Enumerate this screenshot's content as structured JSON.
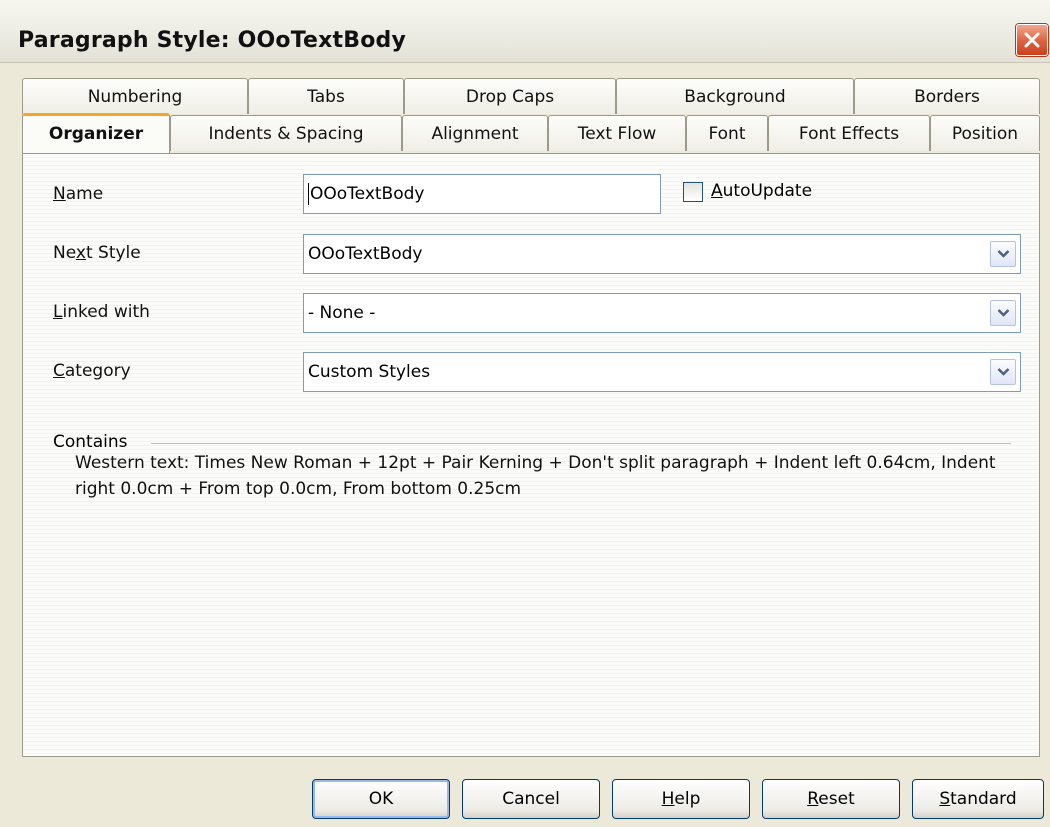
{
  "window": {
    "title": "Paragraph Style: OOoTextBody"
  },
  "tabs": {
    "row1": [
      "Numbering",
      "Tabs",
      "Drop Caps",
      "Background",
      "Borders"
    ],
    "row2": [
      "Organizer",
      "Indents & Spacing",
      "Alignment",
      "Text Flow",
      "Font",
      "Font Effects",
      "Position"
    ],
    "active": "Organizer"
  },
  "organizer": {
    "name": {
      "label_pre": "",
      "label_key": "N",
      "label_post": "ame",
      "value": "OOoTextBody"
    },
    "autoupdate": {
      "label_pre": "",
      "label_key": "A",
      "label_post": "utoUpdate",
      "checked": false
    },
    "next_style": {
      "label_pre": "Ne",
      "label_key": "x",
      "label_post": "t Style",
      "value": "OOoTextBody"
    },
    "linked_with": {
      "label_pre": "",
      "label_key": "L",
      "label_post": "inked with",
      "value": "- None -"
    },
    "category": {
      "label_pre": "",
      "label_key": "C",
      "label_post": "ategory",
      "value": "Custom Styles"
    },
    "contains_label": "Contains",
    "contains_text": "Western text: Times New Roman + 12pt + Pair Kerning + Don't split paragraph + Indent left 0.64cm, Indent right 0.0cm + From top 0.0cm, From bottom 0.25cm"
  },
  "buttons": {
    "ok": {
      "pre": "OK",
      "key": "",
      "post": ""
    },
    "cancel": {
      "pre": "Cancel",
      "key": "",
      "post": ""
    },
    "help": {
      "pre": "",
      "key": "H",
      "post": "elp"
    },
    "reset": {
      "pre": "",
      "key": "R",
      "post": "eset"
    },
    "standard": {
      "pre": "",
      "key": "S",
      "post": "tandard"
    }
  },
  "icons": {
    "close": "close-icon",
    "dropdown": "chevron-down-icon"
  },
  "colors": {
    "active_tab_accent": "#f5a623",
    "close_button": "#e0603d",
    "dialog_background": "#ece9d8"
  }
}
